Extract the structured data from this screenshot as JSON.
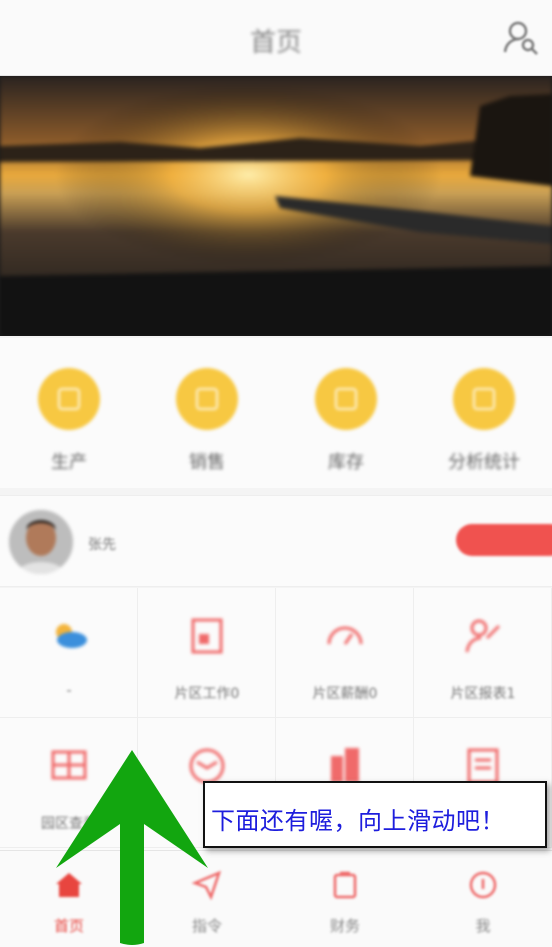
{
  "header": {
    "title": "首页"
  },
  "quick_actions": [
    {
      "label": "生产"
    },
    {
      "label": "销售"
    },
    {
      "label": "库存"
    },
    {
      "label": "分析统计"
    }
  ],
  "user": {
    "name": "张先",
    "button": ""
  },
  "grid": [
    {
      "label": "-"
    },
    {
      "label": "片区工作0"
    },
    {
      "label": "片区薪酬0"
    },
    {
      "label": "片区报表1"
    },
    {
      "label": "园区查看"
    },
    {
      "label": ""
    },
    {
      "label": ""
    },
    {
      "label": ""
    }
  ],
  "tabs": [
    {
      "label": "首页"
    },
    {
      "label": "指令"
    },
    {
      "label": "财务"
    },
    {
      "label": "我"
    }
  ],
  "overlay": {
    "text": "下面还有喔，向上滑动吧！"
  },
  "colors": {
    "accent": "#e8453f",
    "quick": "#f7c842",
    "callout_text": "#1d1ddd",
    "arrow": "#12a60f"
  }
}
